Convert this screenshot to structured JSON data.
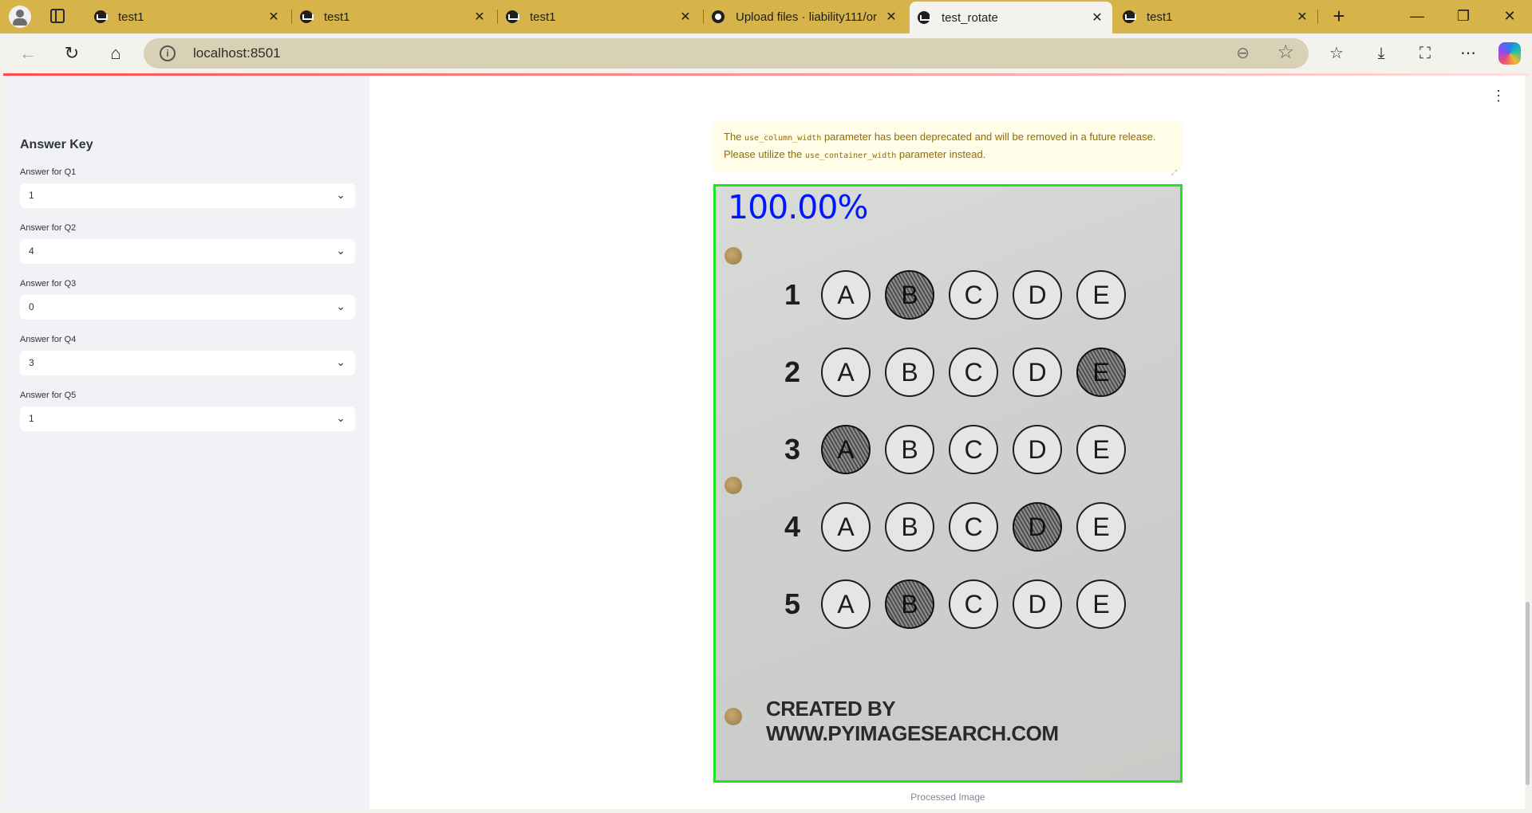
{
  "browser": {
    "tabs": [
      {
        "title": "test1"
      },
      {
        "title": "test1"
      },
      {
        "title": "test1"
      },
      {
        "title": "Upload files · liability111/or"
      },
      {
        "title": "test_rotate"
      },
      {
        "title": "test1"
      }
    ],
    "active_tab": 4,
    "address": "localhost:8501",
    "theme_color": "#d6b44a"
  },
  "sidebar": {
    "title": "Answer Key",
    "fields": [
      {
        "label": "Answer for Q1",
        "value": "1"
      },
      {
        "label": "Answer for Q2",
        "value": "4"
      },
      {
        "label": "Answer for Q3",
        "value": "0"
      },
      {
        "label": "Answer for Q4",
        "value": "3"
      },
      {
        "label": "Answer for Q5",
        "value": "1"
      }
    ]
  },
  "main": {
    "alert": {
      "p1": "The ",
      "code1": "use_column_width",
      "p2": " parameter has been deprecated and will be removed in a future release. Please utilize the ",
      "code2": "use_container_width",
      "p3": " parameter instead."
    },
    "image": {
      "score": "100.00%",
      "questions": [
        {
          "number": "1",
          "options": [
            "A",
            "B",
            "C",
            "D",
            "E"
          ],
          "filled": "B"
        },
        {
          "number": "2",
          "options": [
            "A",
            "B",
            "C",
            "D",
            "E"
          ],
          "filled": "E"
        },
        {
          "number": "3",
          "options": [
            "A",
            "B",
            "C",
            "D",
            "E"
          ],
          "filled": "A"
        },
        {
          "number": "4",
          "options": [
            "A",
            "B",
            "C",
            "D",
            "E"
          ],
          "filled": "D"
        },
        {
          "number": "5",
          "options": [
            "A",
            "B",
            "C",
            "D",
            "E"
          ],
          "filled": "B"
        }
      ],
      "credit": "CREATED BY WWW.PYIMAGESEARCH.COM",
      "border_color": "#1fe41f",
      "score_color": "#0018ff"
    },
    "caption": "Processed Image"
  }
}
